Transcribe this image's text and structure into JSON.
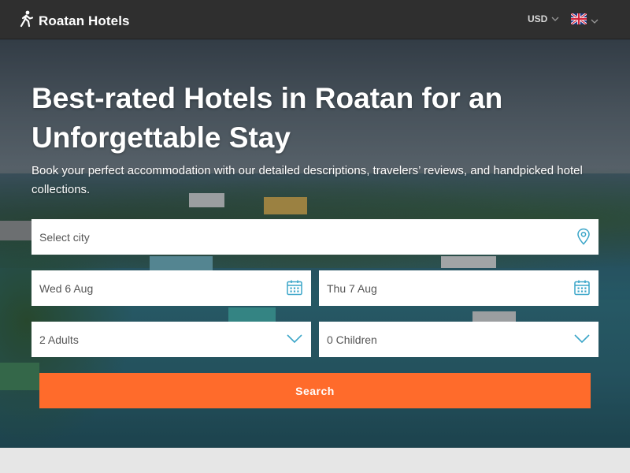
{
  "header": {
    "brand_name": "Roatan Hotels",
    "logo_icon": "walking-person-icon",
    "currency": "USD",
    "language_flag": "uk-flag-icon"
  },
  "hero": {
    "headline": "Best-rated Hotels in Roatan for an Unforgettable Stay",
    "subtitle": "Book your perfect accommodation with our detailed descriptions, travelers’ reviews, and handpicked hotel collections."
  },
  "search_form": {
    "city_placeholder": "Select city",
    "checkin": "Wed 6 Aug",
    "checkout": "Thu 7 Aug",
    "adults": "2 Adults",
    "children": "0 Children",
    "search_label": "Search"
  },
  "colors": {
    "accent": "#ff6b2b",
    "icon_blue": "#3aa5c8",
    "topbar": "#2f2f2f"
  }
}
